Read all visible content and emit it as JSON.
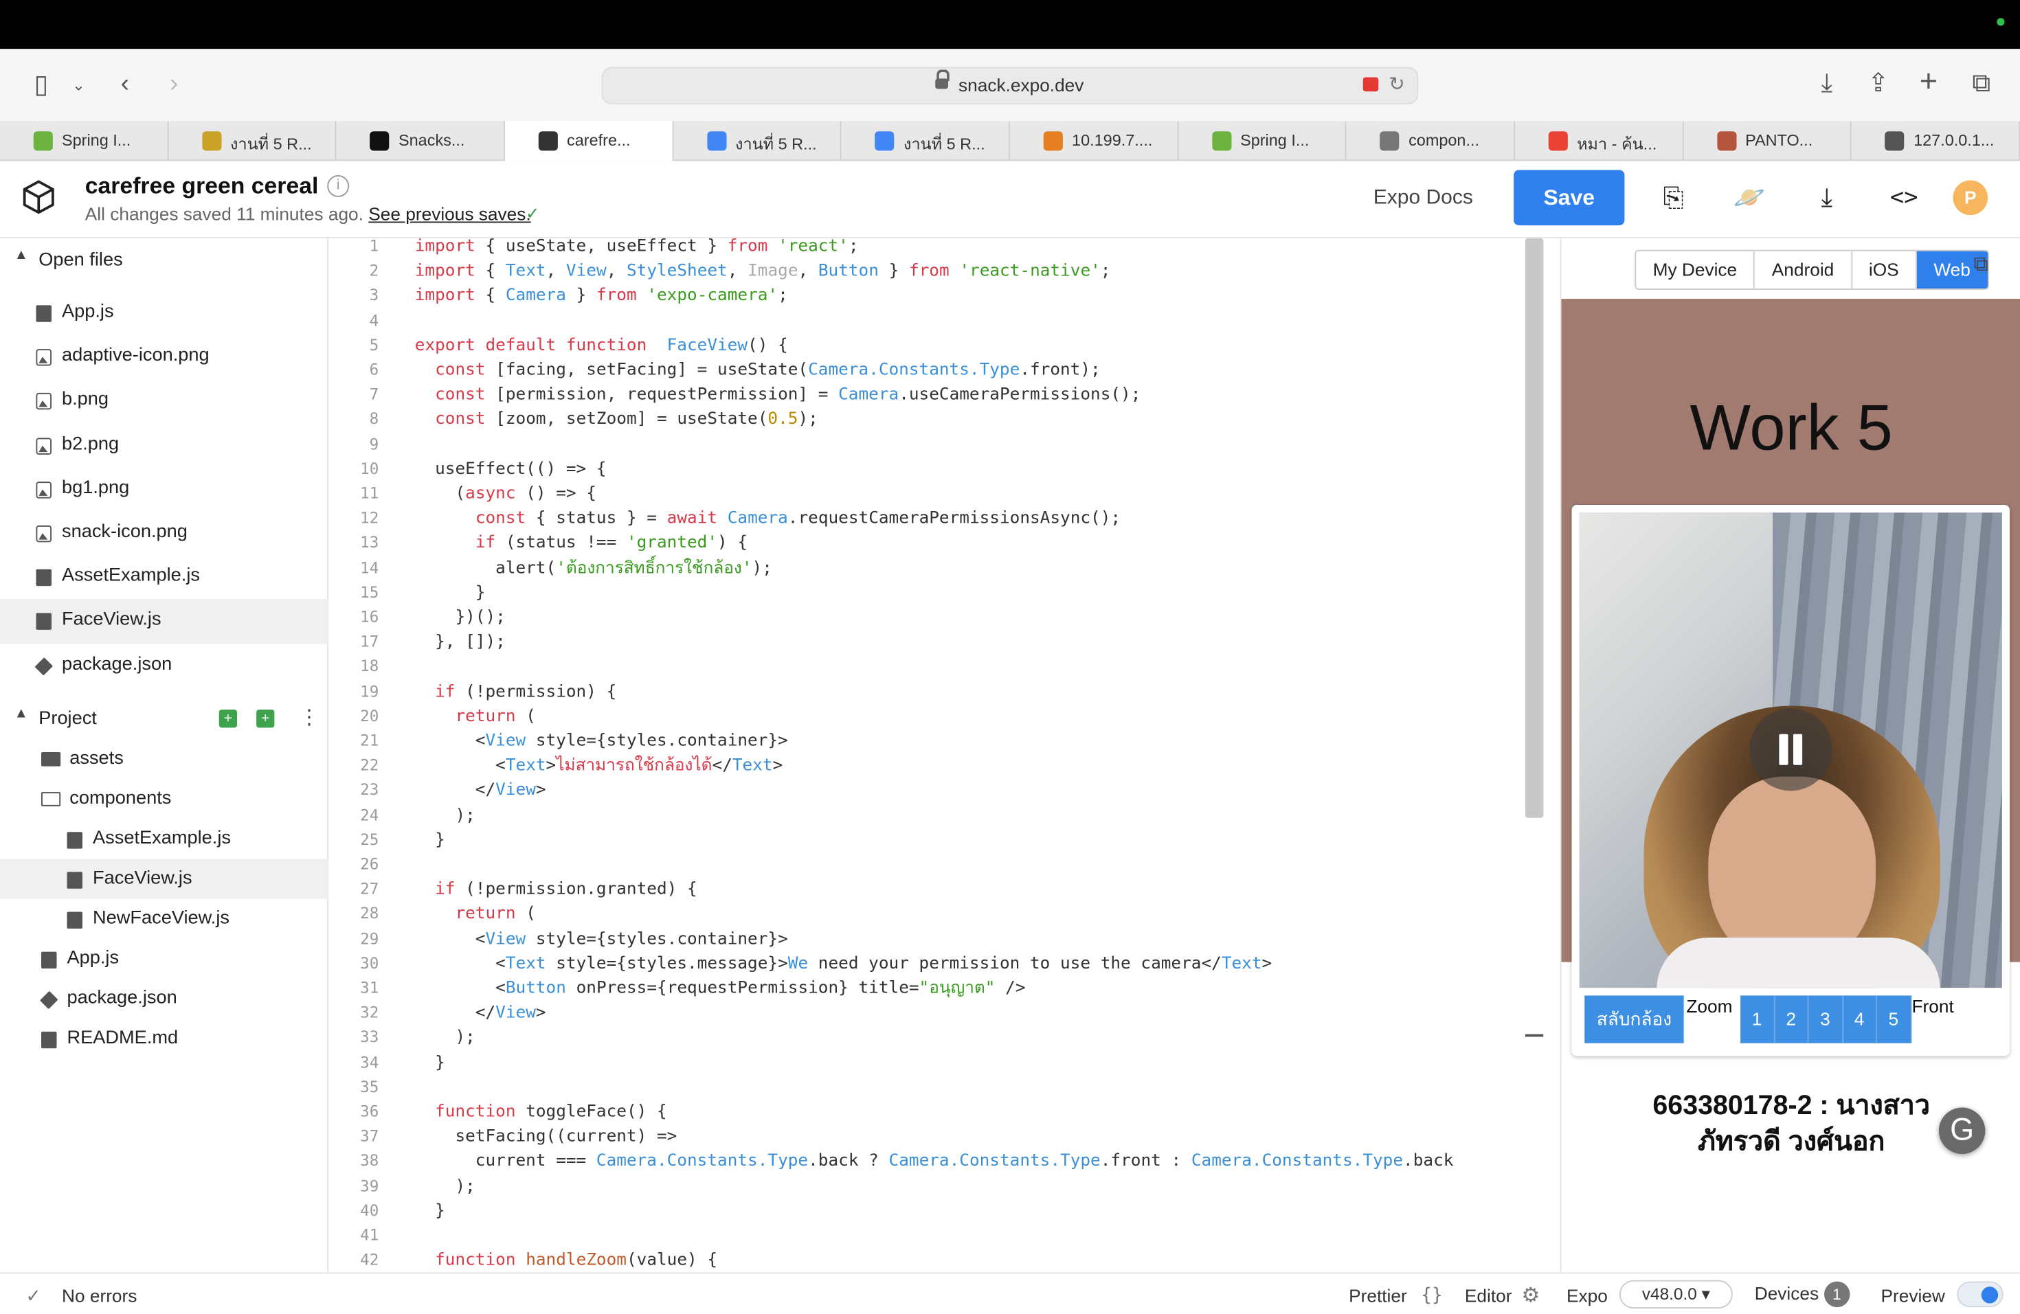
{
  "browser": {
    "url": "snack.expo.dev",
    "tabs": [
      {
        "label": "Spring I...",
        "icon": "spring-icon",
        "color": "#6db33f"
      },
      {
        "label": "งานที่ 5 R...",
        "icon": "classroom-icon",
        "color": "#c9a227"
      },
      {
        "label": "Snacks...",
        "icon": "expo-icon",
        "color": "#111111"
      },
      {
        "label": "carefre...",
        "icon": "snack-icon",
        "color": "#333333",
        "active": true
      },
      {
        "label": "งานที่ 5 R...",
        "icon": "docs-icon",
        "color": "#4285f4"
      },
      {
        "label": "งานที่ 5 R...",
        "icon": "docs-icon",
        "color": "#4285f4"
      },
      {
        "label": "10.199.7....",
        "icon": "pma-icon",
        "color": "#e67e22"
      },
      {
        "label": "Spring I...",
        "icon": "spring-icon",
        "color": "#6db33f"
      },
      {
        "label": "compon...",
        "icon": "g-icon",
        "color": "#777777"
      },
      {
        "label": "หมา - ค้น...",
        "icon": "google-icon",
        "color": "#ea4335"
      },
      {
        "label": "PANTO...",
        "icon": "panto-icon",
        "color": "#b4553c"
      },
      {
        "label": "127.0.0.1...",
        "icon": "page-icon",
        "color": "#555555"
      }
    ]
  },
  "header": {
    "project_title": "carefree green cereal",
    "saved_text": "All changes saved 11 minutes ago.",
    "previous_saves_link": "See previous saves.",
    "expo_docs": "Expo Docs",
    "save_label": "Save",
    "avatar_letter": "P"
  },
  "sidebar": {
    "open_files_label": "Open files",
    "open_files": [
      {
        "name": "App.js",
        "icon": "js"
      },
      {
        "name": "adaptive-icon.png",
        "icon": "img"
      },
      {
        "name": "b.png",
        "icon": "img"
      },
      {
        "name": "b2.png",
        "icon": "img"
      },
      {
        "name": "bg1.png",
        "icon": "img"
      },
      {
        "name": "snack-icon.png",
        "icon": "img"
      },
      {
        "name": "AssetExample.js",
        "icon": "js"
      },
      {
        "name": "FaceView.js",
        "icon": "js",
        "selected": true
      },
      {
        "name": "package.json",
        "icon": "pkg"
      }
    ],
    "project_label": "Project",
    "project_files": [
      {
        "name": "assets",
        "icon": "folder",
        "indent": 0
      },
      {
        "name": "components",
        "icon": "folder-open",
        "indent": 0
      },
      {
        "name": "AssetExample.js",
        "icon": "doc",
        "indent": 1
      },
      {
        "name": "FaceView.js",
        "icon": "doc",
        "indent": 1,
        "selected": true
      },
      {
        "name": "NewFaceView.js",
        "icon": "doc",
        "indent": 1
      },
      {
        "name": "App.js",
        "icon": "js",
        "indent": 0
      },
      {
        "name": "package.json",
        "icon": "pkg",
        "indent": 0
      },
      {
        "name": "README.md",
        "icon": "doc",
        "indent": 0
      }
    ]
  },
  "editor": {
    "lines": [
      [
        [
          "kw",
          "import"
        ],
        [
          "",
          "{ useState, useEffect } "
        ],
        [
          "kw",
          "from"
        ],
        [
          "str",
          " 'react'"
        ],
        [
          "",
          ";"
        ]
      ],
      [
        [
          "kw",
          "import"
        ],
        [
          "",
          "{ "
        ],
        [
          "typ",
          "Text"
        ],
        [
          "",
          ", "
        ],
        [
          "typ",
          "View"
        ],
        [
          "",
          ", "
        ],
        [
          "typ",
          "StyleSheet"
        ],
        [
          "",
          ", "
        ],
        [
          "dim",
          "Image"
        ],
        [
          "",
          ", "
        ],
        [
          "typ",
          "Button"
        ],
        [
          "",
          " } "
        ],
        [
          "kw",
          "from"
        ],
        [
          "str",
          " 'react-native'"
        ],
        [
          "",
          ";"
        ]
      ],
      [
        [
          "kw",
          "import"
        ],
        [
          "",
          "{ "
        ],
        [
          "typ",
          "Camera"
        ],
        [
          "",
          " } "
        ],
        [
          "kw",
          "from"
        ],
        [
          "str",
          " 'expo-camera'"
        ],
        [
          "",
          ";"
        ]
      ],
      [],
      [
        [
          "kw",
          "export default function"
        ],
        [
          "",
          " "
        ],
        [
          "typ",
          "FaceView"
        ],
        [
          "",
          "() {"
        ]
      ],
      [
        [
          "",
          "  "
        ],
        [
          "kw",
          "const"
        ],
        [
          "",
          " [facing, setFacing] = useState("
        ],
        [
          "typ",
          "Camera.Constants.Type"
        ],
        [
          "",
          ".front);"
        ]
      ],
      [
        [
          "",
          "  "
        ],
        [
          "kw",
          "const"
        ],
        [
          "",
          " [permission, requestPermission] = "
        ],
        [
          "typ",
          "Camera"
        ],
        [
          "",
          ".useCameraPermissions();"
        ]
      ],
      [
        [
          "",
          "  "
        ],
        [
          "kw",
          "const"
        ],
        [
          "",
          " [zoom, setZoom] = useState("
        ],
        [
          "num",
          "0.5"
        ],
        [
          "",
          ");"
        ]
      ],
      [],
      [
        [
          "",
          "  useEffect(() => {"
        ]
      ],
      [
        [
          "",
          "    ("
        ],
        [
          "kw",
          "async"
        ],
        [
          "",
          " () => {"
        ]
      ],
      [
        [
          "",
          "      "
        ],
        [
          "kw",
          "const"
        ],
        [
          "",
          " { status } = "
        ],
        [
          "kw",
          "await"
        ],
        [
          "",
          " "
        ],
        [
          "typ",
          "Camera"
        ],
        [
          "",
          ".requestCameraPermissionsAsync();"
        ]
      ],
      [
        [
          "",
          "      "
        ],
        [
          "kw",
          "if"
        ],
        [
          "",
          " (status !== "
        ],
        [
          "str",
          "'granted'"
        ],
        [
          "",
          ") {"
        ]
      ],
      [
        [
          "",
          "        alert("
        ],
        [
          "str",
          "'ต้องการสิทธิ์การใช้กล้อง'"
        ],
        [
          "",
          ");"
        ]
      ],
      [
        [
          "",
          "      }"
        ]
      ],
      [
        [
          "",
          "    })();"
        ]
      ],
      [
        [
          "",
          "  }, []);"
        ]
      ],
      [],
      [
        [
          "",
          "  "
        ],
        [
          "kw",
          "if"
        ],
        [
          "",
          " (!permission) {"
        ]
      ],
      [
        [
          "",
          "    "
        ],
        [
          "kw",
          "return"
        ],
        [
          "",
          " ("
        ]
      ],
      [
        [
          "",
          "      <"
        ],
        [
          "typ",
          "View"
        ],
        [
          "",
          " style={styles.container}>"
        ]
      ],
      [
        [
          "",
          "        <"
        ],
        [
          "typ",
          "Text"
        ],
        [
          "",
          ">"
        ],
        [
          "kw",
          "ไม่สามารถใช้กล้องได้"
        ],
        [
          "",
          "</"
        ],
        [
          "typ",
          "Text"
        ],
        [
          "",
          ">"
        ]
      ],
      [
        [
          "",
          "      </"
        ],
        [
          "typ",
          "View"
        ],
        [
          "",
          ">"
        ]
      ],
      [
        [
          "",
          "    );"
        ]
      ],
      [
        [
          "",
          "  }"
        ]
      ],
      [],
      [
        [
          "",
          "  "
        ],
        [
          "kw",
          "if"
        ],
        [
          "",
          " (!permission.granted) {"
        ]
      ],
      [
        [
          "",
          "    "
        ],
        [
          "kw",
          "return"
        ],
        [
          "",
          " ("
        ]
      ],
      [
        [
          "",
          "      <"
        ],
        [
          "typ",
          "View"
        ],
        [
          "",
          " style={styles.container}>"
        ]
      ],
      [
        [
          "",
          "        <"
        ],
        [
          "typ",
          "Text"
        ],
        [
          "",
          " style={styles.message}>"
        ],
        [
          "typ",
          "We"
        ],
        [
          "",
          " need your permission to use the camera</"
        ],
        [
          "typ",
          "Text"
        ],
        [
          "",
          ">"
        ]
      ],
      [
        [
          "",
          "        <"
        ],
        [
          "typ",
          "Button"
        ],
        [
          "",
          " onPress={requestPermission} title="
        ],
        [
          "str",
          "\"อนุญาต\""
        ],
        [
          "",
          " />"
        ]
      ],
      [
        [
          "",
          "      </"
        ],
        [
          "typ",
          "View"
        ],
        [
          "",
          ">"
        ]
      ],
      [
        [
          "",
          "    );"
        ]
      ],
      [
        [
          "",
          "  }"
        ]
      ],
      [],
      [
        [
          "",
          "  "
        ],
        [
          "kw",
          "function"
        ],
        [
          "",
          " toggleFace() {"
        ]
      ],
      [
        [
          "",
          "    setFacing((current) =>"
        ]
      ],
      [
        [
          "",
          "      current === "
        ],
        [
          "typ",
          "Camera.Constants.Type"
        ],
        [
          "",
          ".back ? "
        ],
        [
          "typ",
          "Camera.Constants.Type"
        ],
        [
          "",
          ".front : "
        ],
        [
          "typ",
          "Camera.Constants.Type"
        ],
        [
          "",
          ".back"
        ]
      ],
      [
        [
          "",
          "    );"
        ]
      ],
      [
        [
          "",
          "  }"
        ]
      ],
      [],
      [
        [
          "",
          "  "
        ],
        [
          "kw",
          "function"
        ],
        [
          "",
          " "
        ],
        [
          "fn",
          "handleZoom"
        ],
        [
          "",
          "(value) {"
        ]
      ]
    ]
  },
  "preview": {
    "modes": [
      "My Device",
      "Android",
      "iOS",
      "Web"
    ],
    "active_mode": "Web",
    "app_title": "Work 5",
    "switch_camera": "สลับกล้อง",
    "zoom_label": "Zoom",
    "zoom_levels": [
      "1",
      "2",
      "3",
      "4",
      "5"
    ],
    "front_label": "Front",
    "student_line1": "663380178-2 : นางสาว",
    "student_line2": "ภัทรวดี วงศ์นอก"
  },
  "status": {
    "errors": "No errors",
    "prettier": "Prettier",
    "editor": "Editor",
    "expo": "Expo",
    "version": "v48.0.0",
    "devices": "Devices",
    "devices_count": "1",
    "preview": "Preview"
  }
}
